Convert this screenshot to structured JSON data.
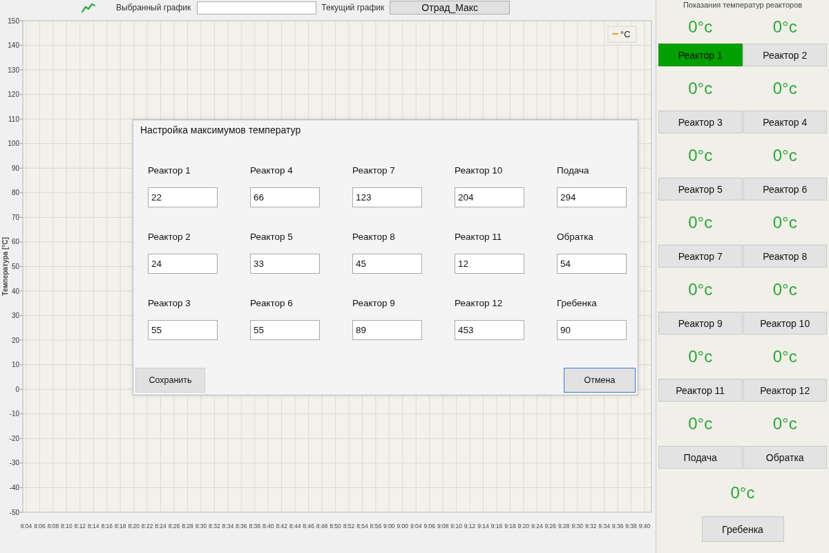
{
  "toolbar": {
    "selected_chart_label": "Выбранный график",
    "current_chart_label": "Текущий график",
    "current_chart_button": "Отрад_Макс"
  },
  "chart": {
    "chart_data": {
      "type": "line",
      "grid": true,
      "ylabel": "Температура [°C]",
      "categories": [
        "8:04",
        "8:06",
        "8:08",
        "8:10",
        "8:12",
        "8:14",
        "8:16",
        "8:18",
        "8:20",
        "8:22",
        "8:24",
        "8:26",
        "8:28",
        "8:30",
        "8:32",
        "8:34",
        "8:36",
        "8:38",
        "8:40",
        "8:42",
        "8:44",
        "8:46",
        "8:48",
        "8:50",
        "8:52",
        "8:54",
        "8:56",
        "9:00",
        "9:00",
        "9:04",
        "9:06",
        "9:08",
        "9:10",
        "9:12",
        "9:14",
        "9:16",
        "9:18",
        "9:20",
        "9:24",
        "9:26",
        "9:28",
        "9:30",
        "9:32",
        "9:34",
        "9:36",
        "9:38",
        "9:40"
      ],
      "ylim": [
        -50,
        150
      ],
      "yticks": [
        -50,
        -40,
        -30,
        -20,
        -10,
        0,
        10,
        20,
        30,
        40,
        50,
        60,
        70,
        80,
        90,
        100,
        110,
        120,
        130,
        140,
        150
      ],
      "series": [
        {
          "name": "°C",
          "color": "#f0a030",
          "values": [
            null,
            null,
            null,
            null,
            null,
            null,
            null,
            null,
            null,
            null,
            null,
            null,
            null,
            null,
            null,
            null,
            null,
            null,
            null,
            null,
            null,
            null,
            null,
            null,
            null,
            null,
            null,
            null,
            null,
            null,
            null,
            null,
            null,
            null,
            null,
            null,
            null,
            null,
            null,
            null,
            null,
            null,
            null,
            null,
            null,
            null,
            null
          ]
        }
      ]
    }
  },
  "dialog": {
    "title": "Настройка максимумов температур",
    "fields": [
      {
        "label": "Реактор 1",
        "value": "22"
      },
      {
        "label": "Реактор 4",
        "value": "66"
      },
      {
        "label": "Реактор 7",
        "value": "123"
      },
      {
        "label": "Реактор 10",
        "value": "204"
      },
      {
        "label": "Подача",
        "value": "294"
      },
      {
        "label": "Реактор 2",
        "value": "24"
      },
      {
        "label": "Реактор 5",
        "value": "33"
      },
      {
        "label": "Реактор 8",
        "value": "45"
      },
      {
        "label": "Реактор 11",
        "value": "12"
      },
      {
        "label": "Обратка",
        "value": "54"
      },
      {
        "label": "Реактор 3",
        "value": "55"
      },
      {
        "label": "Реактор 6",
        "value": "55"
      },
      {
        "label": "Реактор 9",
        "value": "89"
      },
      {
        "label": "Реактор 12",
        "value": "453"
      },
      {
        "label": "Гребенка",
        "value": "90"
      }
    ],
    "buttons": [
      {
        "label": "Сохранить",
        "focused": false
      },
      {
        "label": "Отмена",
        "focused": true
      }
    ]
  },
  "sensor_panel": {
    "title": "Показания температур реакторов",
    "sensors": [
      {
        "reading": "0°c",
        "label": "Реактор 1",
        "selected": true
      },
      {
        "reading": "0°c",
        "label": "Реактор 2",
        "selected": false
      },
      {
        "reading": "0°c",
        "label": "Реактор 3",
        "selected": false
      },
      {
        "reading": "0°c",
        "label": "Реактор 4",
        "selected": false
      },
      {
        "reading": "0°c",
        "label": "Реактор 5",
        "selected": false
      },
      {
        "reading": "0°c",
        "label": "Реактор 6",
        "selected": false
      },
      {
        "reading": "0°c",
        "label": "Реактор 7",
        "selected": false
      },
      {
        "reading": "0°c",
        "label": "Реактор 8",
        "selected": false
      },
      {
        "reading": "0°c",
        "label": "Реактор 9",
        "selected": false
      },
      {
        "reading": "0°c",
        "label": "Реактор 10",
        "selected": false
      },
      {
        "reading": "0°c",
        "label": "Реактор 11",
        "selected": false
      },
      {
        "reading": "0°c",
        "label": "Реактор 12",
        "selected": false
      },
      {
        "reading": "0°c",
        "label": "Подача",
        "selected": false
      },
      {
        "reading": "0°c",
        "label": "Обратка",
        "selected": false
      },
      {
        "reading": "0°c",
        "label": "Гребенка",
        "selected": false
      }
    ]
  }
}
